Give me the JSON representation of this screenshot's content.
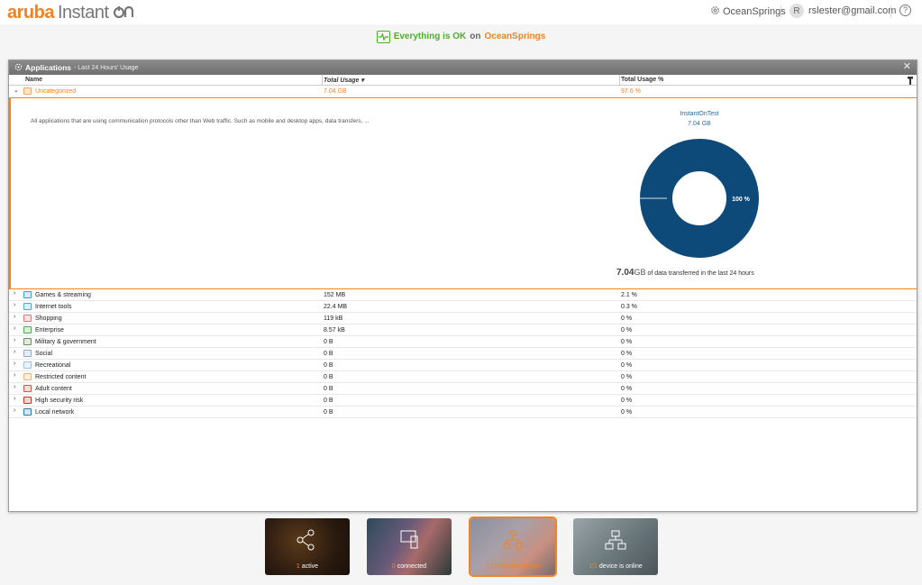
{
  "brand": {
    "name": "aruba",
    "product": "Instant",
    "on": "On"
  },
  "topbar": {
    "site": "OceanSprings",
    "user_initial": "R",
    "user_email": "rslester@gmail.com",
    "help": "?"
  },
  "status": {
    "ok_text": "Everything is OK",
    "on_text": "on",
    "site": "OceanSprings"
  },
  "panel": {
    "title": "Applications",
    "subtitle": "- Last 24 Hours' Usage",
    "columns": {
      "name": "Name",
      "total_usage": "Total Usage",
      "total_pct": "Total Usage %"
    },
    "expanded_row": {
      "name": "Uncategorized",
      "usage": "7.04 GB",
      "pct": "97.6 %"
    },
    "detail": {
      "description": "All applications that are using communication protocols other than Web traffic. Such as mobile and desktop apps, data transfers, ...",
      "device": "InstantOnTest",
      "device_usage": "7.04 GB",
      "slice_label": "100 %",
      "transfer_value": "7.04",
      "transfer_unit": "GB",
      "transfer_text": "of data transferred in the last 24 hours"
    },
    "rows": [
      {
        "name": "Games & streaming",
        "usage": "152 MB",
        "pct": "2.1 %",
        "color": "#3a9bd8"
      },
      {
        "name": "Internet tools",
        "usage": "22.4 MB",
        "pct": "0.3 %",
        "color": "#5aa7c9"
      },
      {
        "name": "Shopping",
        "usage": "119 kB",
        "pct": "0 %",
        "color": "#e07a7a"
      },
      {
        "name": "Enterprise",
        "usage": "8.57 kB",
        "pct": "0 %",
        "color": "#4caf50"
      },
      {
        "name": "Military & government",
        "usage": "0 B",
        "pct": "0 %",
        "color": "#6d8f5e"
      },
      {
        "name": "Social",
        "usage": "0 B",
        "pct": "0 %",
        "color": "#8aa8c8"
      },
      {
        "name": "Recreational",
        "usage": "0 B",
        "pct": "0 %",
        "color": "#9bc4e2"
      },
      {
        "name": "Restricted content",
        "usage": "0 B",
        "pct": "0 %",
        "color": "#f0b27a"
      },
      {
        "name": "Adult content",
        "usage": "0 B",
        "pct": "0 %",
        "color": "#d9534f"
      },
      {
        "name": "High security risk",
        "usage": "0 B",
        "pct": "0 %",
        "color": "#c0392b"
      },
      {
        "name": "Local network",
        "usage": "0 B",
        "pct": "0 %",
        "color": "#2b7bbf"
      }
    ]
  },
  "tiles": [
    {
      "num": "1",
      "label": "active",
      "icon": "network-share-icon"
    },
    {
      "num": "0",
      "label": "connected",
      "icon": "devices-icon"
    },
    {
      "num": "7.21 GB",
      "label": "transferred",
      "icon": "data-flow-icon"
    },
    {
      "num": "1/1",
      "label": "device is online",
      "icon": "network-topology-icon"
    }
  ],
  "colors": {
    "accent": "#f58220",
    "ok": "#4caf2a",
    "donut": "#0d4a79"
  }
}
